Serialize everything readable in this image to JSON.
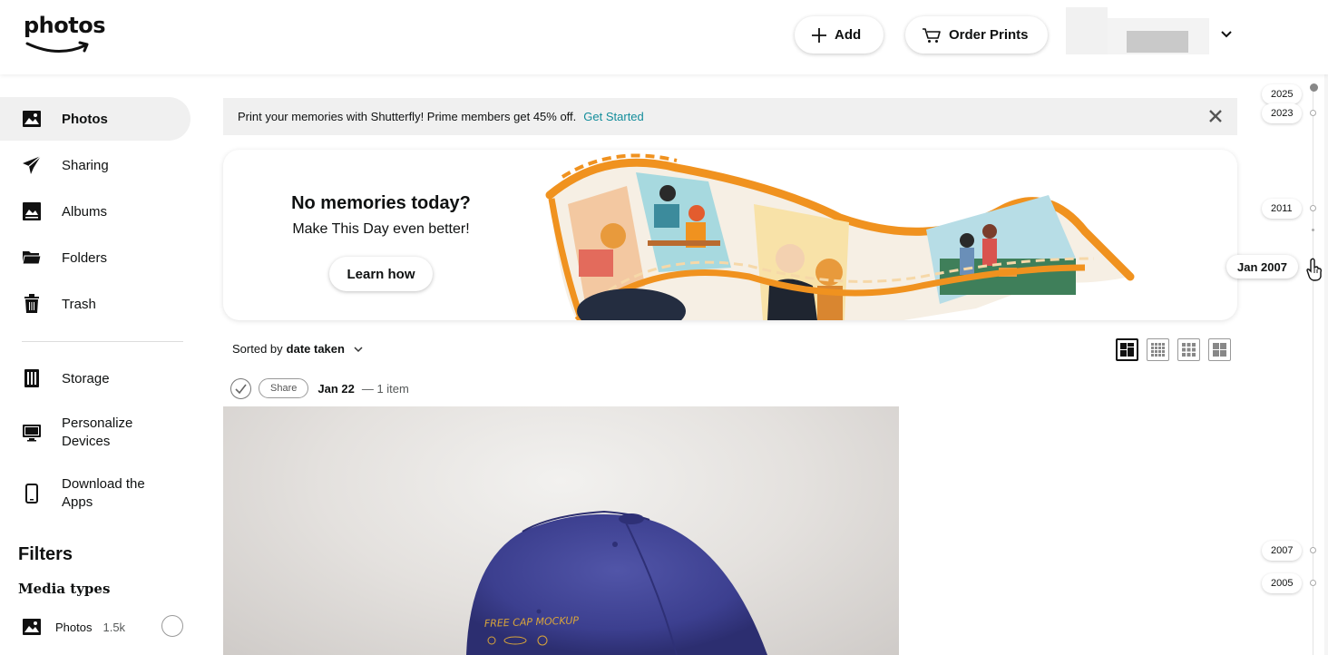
{
  "header": {
    "logo": "photos",
    "add_label": "Add",
    "order_prints_label": "Order Prints"
  },
  "sidebar": {
    "items": [
      {
        "label": "Photos",
        "icon": "photo-icon"
      },
      {
        "label": "Sharing",
        "icon": "paper-plane-icon"
      },
      {
        "label": "Albums",
        "icon": "album-icon"
      },
      {
        "label": "Folders",
        "icon": "folder-icon"
      },
      {
        "label": "Trash",
        "icon": "trash-icon"
      }
    ],
    "secondary": [
      {
        "label": "Storage",
        "icon": "storage-icon"
      },
      {
        "label": "Personalize Devices",
        "icon": "monitor-icon"
      },
      {
        "label": "Download the Apps",
        "icon": "phone-icon"
      }
    ],
    "filters_title": "Filters",
    "media_types_title": "Media types",
    "media_types": [
      {
        "label": "Photos",
        "count": "1.5k"
      }
    ]
  },
  "banner": {
    "text": "Print your memories with Shutterfly! Prime members get 45% off.",
    "link": "Get Started"
  },
  "memories": {
    "title": "No memories today?",
    "subtitle": "Make This Day even better!",
    "button": "Learn how"
  },
  "sort": {
    "prefix": "Sorted by",
    "value": "date taken"
  },
  "group": {
    "share_label": "Share",
    "date": "Jan 22",
    "count": "— 1 item"
  },
  "photo": {
    "caption": "FREE CAP MOCKUP"
  },
  "timeline": {
    "years": [
      "2025",
      "2023",
      "2011",
      "2007",
      "2005"
    ],
    "current": "Jan 2007"
  },
  "colors": {
    "link": "#138d9b",
    "accent_orange": "#f0921f",
    "cap_blue": "#3c3f8f"
  }
}
